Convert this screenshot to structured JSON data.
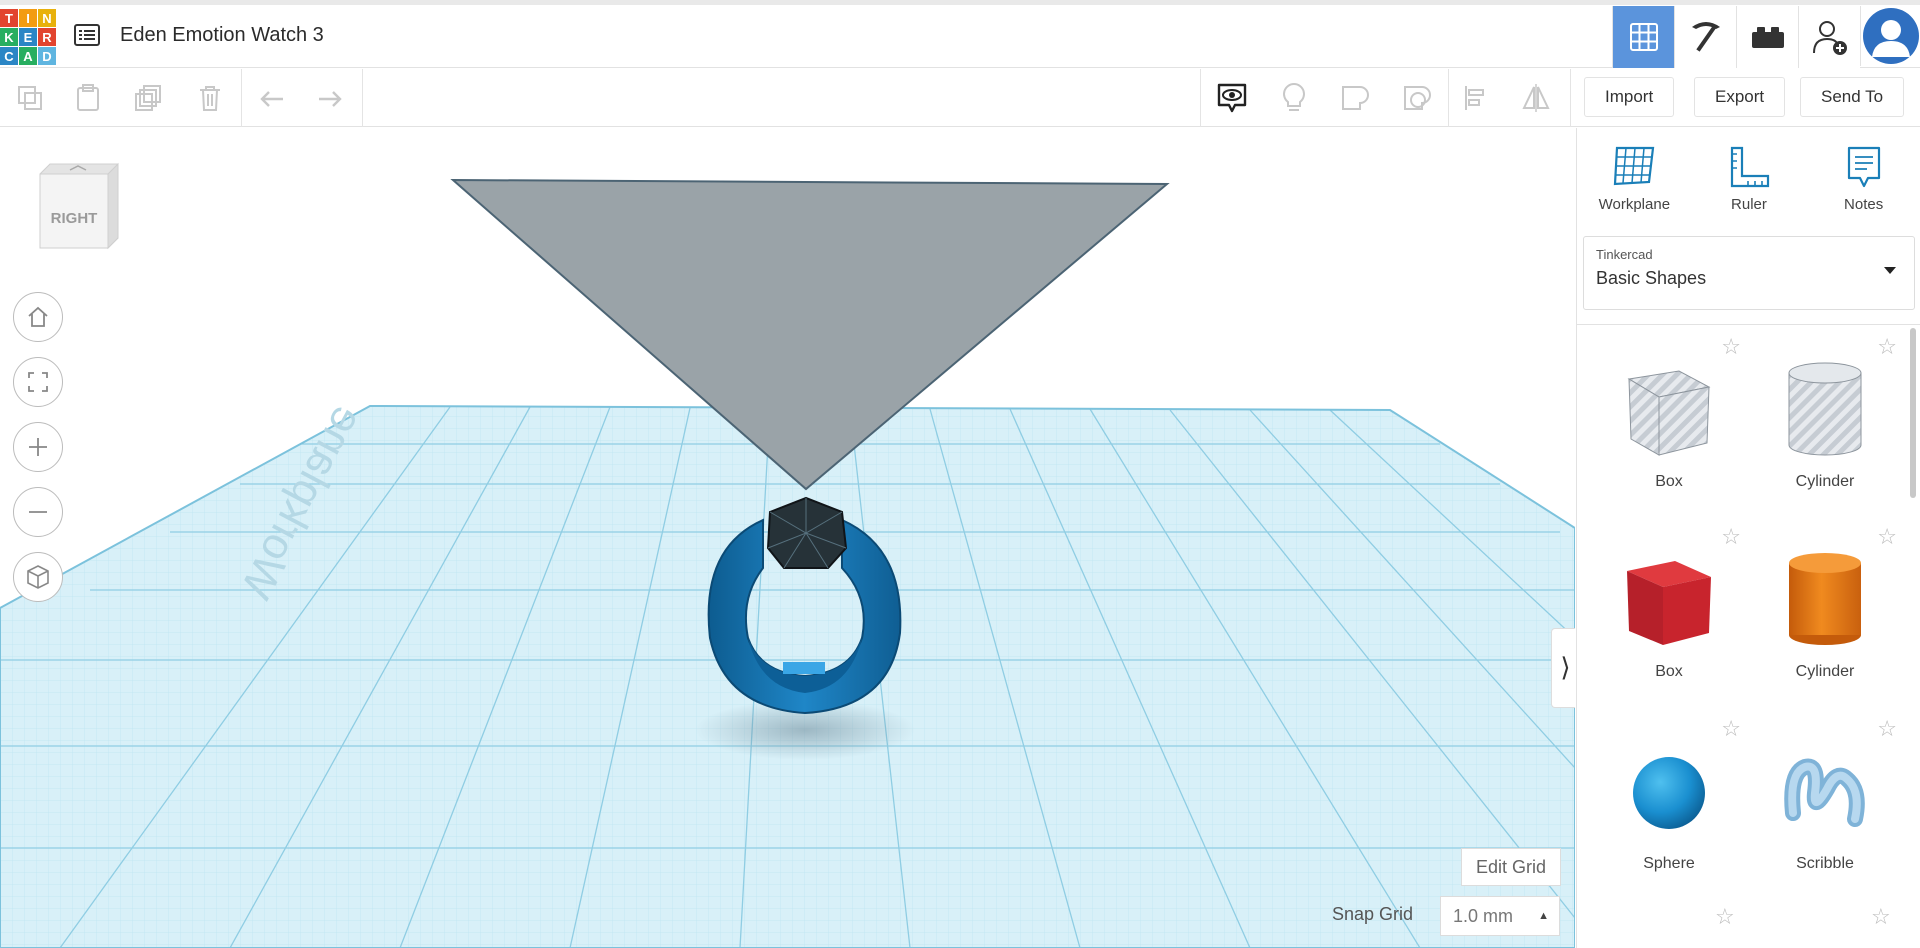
{
  "logo": {
    "letters": [
      "T",
      "I",
      "N",
      "K",
      "E",
      "R",
      "C",
      "A",
      "D"
    ],
    "colors": [
      "#e2442f",
      "#f39c12",
      "#f1c40f",
      "#27ae60",
      "#2b86c5",
      "#e2442f",
      "#9b59b6",
      "#27ae60",
      "#2b86c5"
    ]
  },
  "header": {
    "title": "Eden Emotion Watch 3"
  },
  "toolbar": {
    "import_label": "Import",
    "export_label": "Export",
    "send_to_label": "Send To"
  },
  "viewcube": {
    "face": "RIGHT"
  },
  "workplane_watermark": "Workplane",
  "panel": {
    "tools": [
      {
        "label": "Workplane"
      },
      {
        "label": "Ruler"
      },
      {
        "label": "Notes"
      }
    ],
    "library": {
      "category": "Tinkercad",
      "name": "Basic Shapes"
    },
    "shapes": [
      {
        "label": "Box",
        "icon": "box-hole-icon"
      },
      {
        "label": "Cylinder",
        "icon": "cylinder-hole-icon"
      },
      {
        "label": "Box",
        "icon": "box-red-icon"
      },
      {
        "label": "Cylinder",
        "icon": "cylinder-orange-icon"
      },
      {
        "label": "Sphere",
        "icon": "sphere-blue-icon"
      },
      {
        "label": "Scribble",
        "icon": "scribble-icon"
      }
    ]
  },
  "grid": {
    "edit_label": "Edit Grid",
    "snap_label": "Snap Grid",
    "snap_value": "1.0 mm"
  },
  "colors": {
    "accent": "#5b94dc",
    "grid": "#a9dbea",
    "cone": "#9aa3a8",
    "ring": "#1f78b4"
  }
}
